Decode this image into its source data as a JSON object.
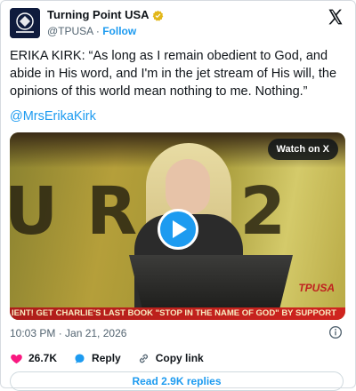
{
  "author": {
    "display_name": "Turning Point USA",
    "handle": "@TPUSA",
    "separator": "·",
    "follow_label": "Follow",
    "avatar_icon": "tpusa-logo-icon"
  },
  "tweet": {
    "text": "ERIKA KIRK: “As long as I remain obedient to God, and abide in His word, and I'm in the jet stream of His will, the opinions of this world mean nothing to me. Nothing.”",
    "mention": "@MrsErikaKirk"
  },
  "video": {
    "watch_label": "Watch on X",
    "ticker_text": "IENT!        GET CHARLIE'S LAST BOOK \"STOP IN THE NAME OF GOD\" BY SUPPORT",
    "play_icon": "play-icon",
    "stage_letters": "UR02",
    "stage_logo": "TPUSA"
  },
  "meta": {
    "timestamp": "10:03 PM · Jan 21, 2026"
  },
  "actions": {
    "likes": "26.7K",
    "reply_label": "Reply",
    "copy_link_label": "Copy link"
  },
  "replies_button": "Read 2.9K replies",
  "colors": {
    "accent": "#1d9bf0",
    "like": "#f91880",
    "muted": "#536471",
    "verified": "#e2b719"
  }
}
